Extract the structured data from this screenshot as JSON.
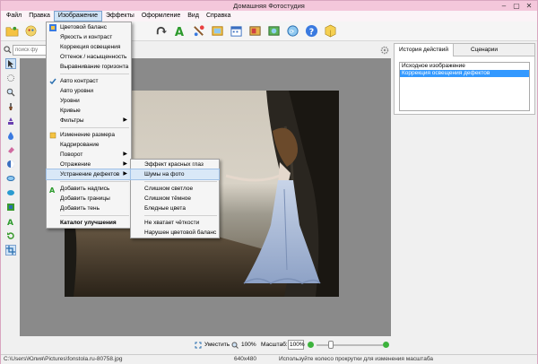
{
  "window": {
    "title": "Домашняя Фотостудия"
  },
  "menubar": [
    "Файл",
    "Правка",
    "Изображение",
    "Эффекты",
    "Оформление",
    "Вид",
    "Справка"
  ],
  "search": {
    "placeholder": "поиск фу"
  },
  "image_menu": {
    "items": [
      {
        "label": "Цветовой баланс",
        "icon": "color-balance-icon"
      },
      {
        "label": "Яркость и контраст",
        "icon": ""
      },
      {
        "label": "Коррекция освещения",
        "icon": ""
      },
      {
        "label": "Оттенок / насыщенность",
        "icon": ""
      },
      {
        "label": "Выравнивание горизонта",
        "icon": ""
      },
      {
        "label": "Авто контраст",
        "icon": "auto-contrast-icon"
      },
      {
        "label": "Авто уровни",
        "icon": ""
      },
      {
        "label": "Уровни",
        "icon": ""
      },
      {
        "label": "Кривые",
        "icon": ""
      },
      {
        "label": "Фильтры",
        "icon": ""
      },
      {
        "label": "Изменение размера",
        "icon": "resize-icon"
      },
      {
        "label": "Кадрирование",
        "icon": ""
      },
      {
        "label": "Поворот",
        "icon": ""
      },
      {
        "label": "Отражение",
        "icon": ""
      },
      {
        "label": "Устранение дефектов",
        "icon": ""
      },
      {
        "label": "Добавить надпись",
        "icon": "text-icon"
      },
      {
        "label": "Добавить границы",
        "icon": ""
      },
      {
        "label": "Добавить тень",
        "icon": ""
      },
      {
        "label": "Каталог улучшения",
        "icon": ""
      }
    ]
  },
  "defects_submenu": {
    "items": [
      "Эффект красных глаз",
      "Шумы на фото",
      "Слишком светлое",
      "Слишком тёмное",
      "Бледные цвета",
      "Не хватает чёткости",
      "Нарушен цветовой баланс"
    ]
  },
  "history_panel": {
    "tabs": [
      "История действий",
      "Сценарии"
    ],
    "items": [
      "Исходное изображение",
      "Коррекция освещения дефектов"
    ]
  },
  "bottombar": {
    "fit_label": "Уместить",
    "percent_label": "100%",
    "scale_label": "Масштаб:",
    "scale_value": "100%"
  },
  "statusbar": {
    "path": "C:\\Users\\Юлия\\Pictures\\fonstola.ru-80758.jpg",
    "dimensions": "640x480",
    "hint": "Используйте колесо прокрутки для изменения масштаба"
  },
  "colors": {
    "titlebar": "#f4c7db",
    "highlight": "#3399ff",
    "menu_hover": "#d9e8f7"
  }
}
